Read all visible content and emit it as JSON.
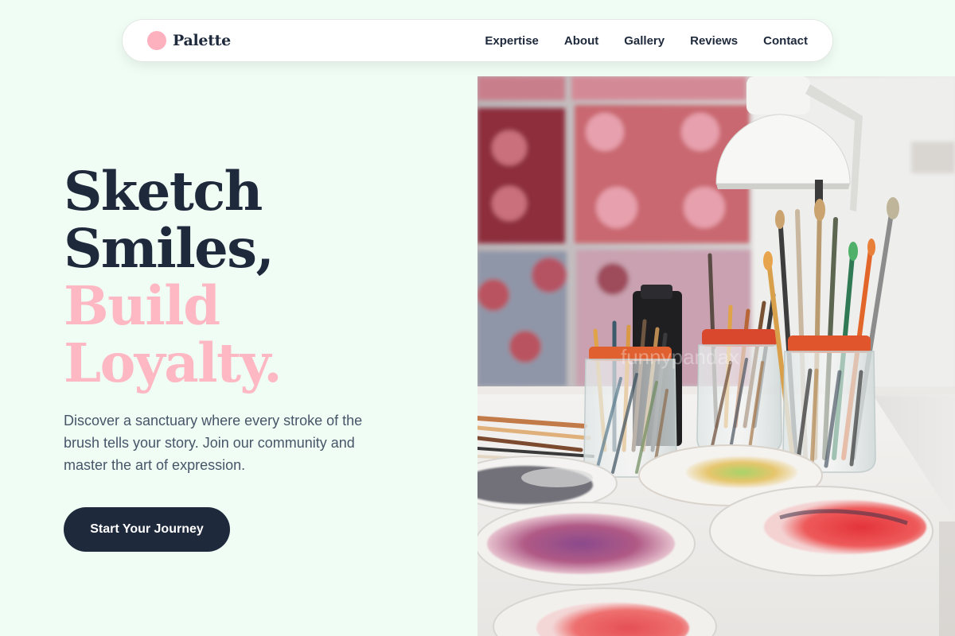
{
  "brand": {
    "name": "Palette",
    "logo_icon": "circle-icon",
    "accent_color": "#fdb0bd"
  },
  "nav": {
    "links": [
      "Expertise",
      "About",
      "Gallery",
      "Reviews",
      "Contact"
    ]
  },
  "hero": {
    "headline_dark": [
      "Sketch",
      "Smiles,"
    ],
    "headline_pink": [
      "Build",
      "Loyalty."
    ],
    "subtitle": "Discover a sanctuary where every stroke of the brush tells your story. Join our community and master the art of expression.",
    "cta_label": "Start Your Journey",
    "image_watermark": "funnypandax"
  },
  "colors": {
    "background": "#f0fdf4",
    "dark": "#1e293b",
    "pink": "#fdb8c3",
    "text_muted": "#475569"
  }
}
